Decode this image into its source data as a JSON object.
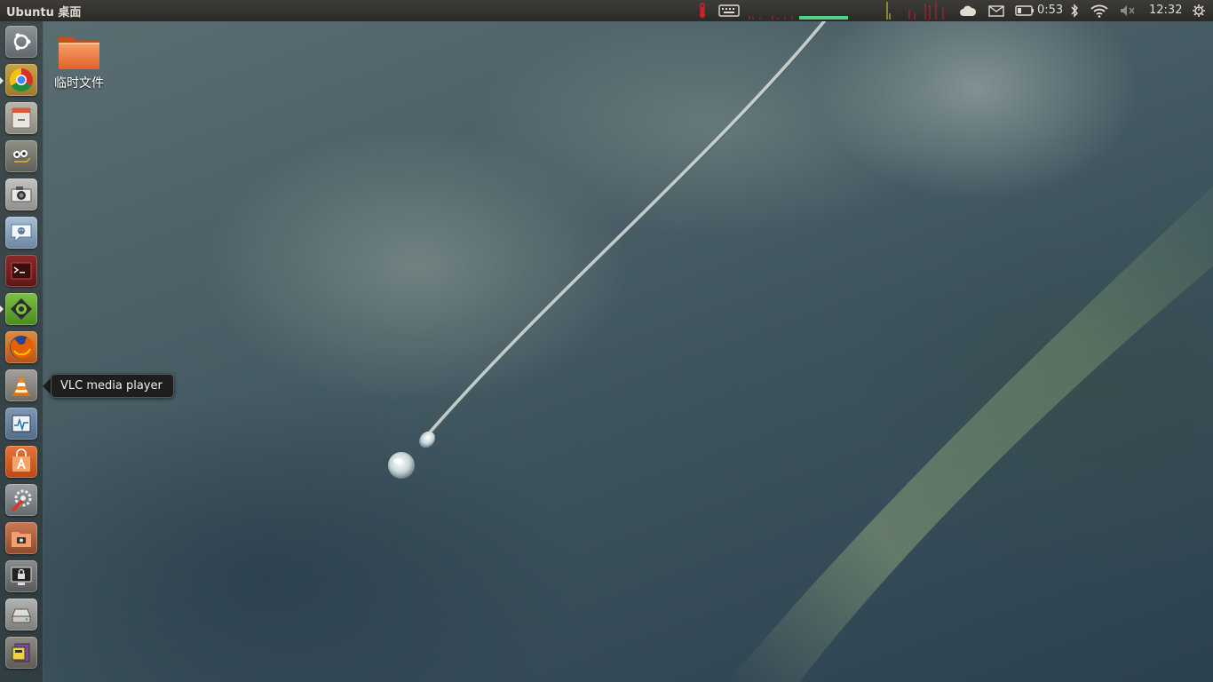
{
  "top_panel": {
    "window_title": "Ubuntu 桌面",
    "battery_time": "0:53",
    "clock": "12:32",
    "tray_icons": [
      "thermometer-icon",
      "keyboard-icon",
      "system-load-graph",
      "network-load-graph",
      "cloud-icon",
      "mail-icon",
      "battery-icon",
      "bluetooth-icon",
      "wifi-icon",
      "volume-muted-icon",
      "session-gear-icon"
    ]
  },
  "launcher": {
    "items": [
      {
        "name": "dash-home-button",
        "icon": "ubuntu-logo-icon"
      },
      {
        "name": "launcher-item-chrome",
        "icon": "chrome-icon",
        "running": true
      },
      {
        "name": "launcher-item-files",
        "icon": "file-cabinet-icon"
      },
      {
        "name": "launcher-item-gimp",
        "icon": "gimp-icon"
      },
      {
        "name": "launcher-item-camera",
        "icon": "camera-icon"
      },
      {
        "name": "launcher-item-messaging",
        "icon": "chat-bubble-icon"
      },
      {
        "name": "launcher-item-terminal",
        "icon": "terminal-icon"
      },
      {
        "name": "launcher-item-qt-creator",
        "icon": "qt-creator-icon",
        "running": true
      },
      {
        "name": "launcher-item-firefox",
        "icon": "firefox-icon"
      },
      {
        "name": "launcher-item-vlc",
        "icon": "vlc-cone-icon"
      },
      {
        "name": "launcher-item-system-monitor",
        "icon": "system-monitor-icon"
      },
      {
        "name": "launcher-item-software-center",
        "icon": "software-center-bag-icon"
      },
      {
        "name": "launcher-item-system-settings",
        "icon": "settings-wrench-icon"
      },
      {
        "name": "launcher-item-screenshot",
        "icon": "folder-camera-icon"
      },
      {
        "name": "launcher-item-lock-screen",
        "icon": "monitor-lock-icon"
      },
      {
        "name": "launcher-item-drive",
        "icon": "hard-drive-icon"
      },
      {
        "name": "launcher-item-workspaces",
        "icon": "workspace-switcher-icon"
      }
    ]
  },
  "tooltip": {
    "label": "VLC media player"
  },
  "desktop": {
    "icons": [
      {
        "label": "临时文件",
        "icon": "orange-folder-icon"
      }
    ]
  },
  "colors": {
    "panel_bg": "#2b2a27",
    "ubuntu_orange": "#dd4814",
    "tooltip_bg": "#1e1e1e"
  }
}
